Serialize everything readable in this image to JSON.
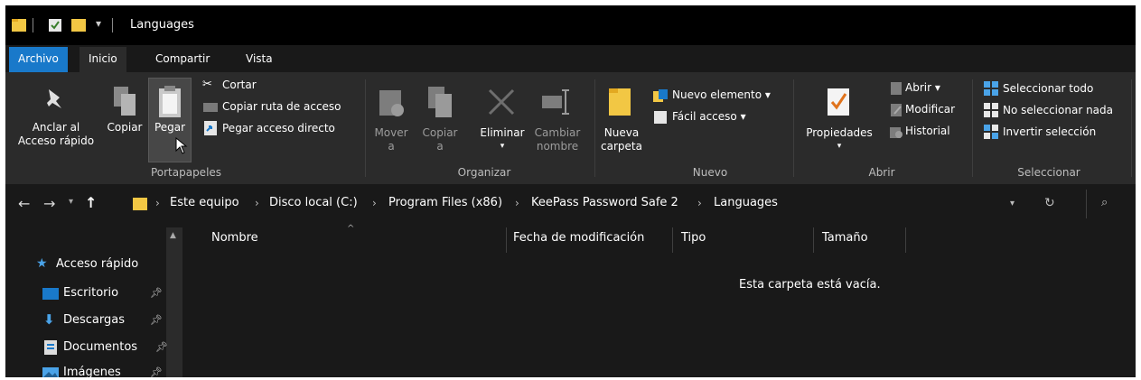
{
  "window": {
    "title": "Languages"
  },
  "tabs": {
    "file": "Archivo",
    "home": "Inicio",
    "share": "Compartir",
    "view": "Vista"
  },
  "ribbon": {
    "clipboard": {
      "pin_line1": "Anclar al",
      "pin_line2": "Acceso rápido",
      "copy": "Copiar",
      "paste": "Pegar",
      "cut": "Cortar",
      "copy_path": "Copiar ruta de acceso",
      "paste_shortcut": "Pegar acceso directo",
      "group": "Portapapeles"
    },
    "organize": {
      "move_line1": "Mover",
      "move_line2": "a",
      "copyto_line1": "Copiar",
      "copyto_line2": "a",
      "delete": "Eliminar",
      "rename_line1": "Cambiar",
      "rename_line2": "nombre",
      "group": "Organizar"
    },
    "new": {
      "folder_line1": "Nueva",
      "folder_line2": "carpeta",
      "new_item": "Nuevo elemento ▾",
      "easy_access": "Fácil acceso ▾",
      "group": "Nuevo"
    },
    "open": {
      "properties": "Propiedades",
      "open": "Abrir ▾",
      "edit": "Modificar",
      "history": "Historial",
      "group": "Abrir"
    },
    "select": {
      "select_all": "Seleccionar todo",
      "select_none": "No seleccionar nada",
      "invert": "Invertir selección",
      "group": "Seleccionar"
    }
  },
  "address": {
    "crumbs": [
      "Este equipo",
      "Disco local (C:)",
      "Program Files (x86)",
      "KeePass Password Safe 2",
      "Languages"
    ]
  },
  "nav": {
    "quick_access": "Acceso rápido",
    "items": [
      "Escritorio",
      "Descargas",
      "Documentos",
      "Imágenes"
    ]
  },
  "columns": {
    "name": "Nombre",
    "modified": "Fecha de modificación",
    "type": "Tipo",
    "size": "Tamaño"
  },
  "empty_message": "Esta carpeta está vacía.",
  "colors": {
    "accent": "#1979ca",
    "background": "#191919",
    "ribbon": "#2b2b2b",
    "folder": "#f2c744"
  }
}
